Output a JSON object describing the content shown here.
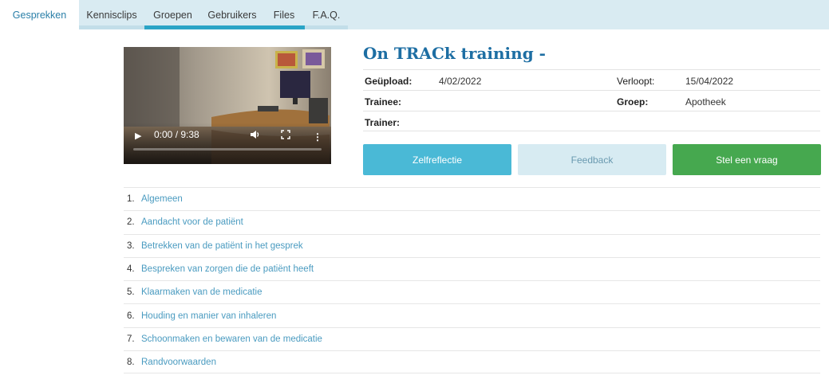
{
  "nav": {
    "tabs": [
      {
        "label": "Gesprekken"
      },
      {
        "label": "Kennisclips"
      },
      {
        "label": "Groepen"
      },
      {
        "label": "Gebruikers"
      },
      {
        "label": "Files"
      },
      {
        "label": "F.A.Q."
      }
    ],
    "active": "Gesprekken"
  },
  "video": {
    "time": "0:00 / 9:38",
    "progress": 0
  },
  "session": {
    "title": "On TRACk training -",
    "uploaded_label": "Geüpload:",
    "uploaded_value": "4/02/2022",
    "expires_label": "Verloopt:",
    "expires_value": "15/04/2022",
    "trainee_label": "Trainee:",
    "trainee_value": "",
    "group_label": "Groep:",
    "group_value": "Apotheek",
    "trainer_label": "Trainer:",
    "trainer_value": ""
  },
  "actions": {
    "selfreflection": "Zelfreflectie",
    "feedback": "Feedback",
    "ask_question": "Stel een vraag"
  },
  "topics": [
    {
      "num": "1.",
      "label": "Algemeen"
    },
    {
      "num": "2.",
      "label": "Aandacht voor de patiënt"
    },
    {
      "num": "3.",
      "label": "Betrekken van de patiënt in het gesprek"
    },
    {
      "num": "4.",
      "label": "Bespreken van zorgen die de patiënt heeft"
    },
    {
      "num": "5.",
      "label": "Klaarmaken van de medicatie"
    },
    {
      "num": "6.",
      "label": "Houding en manier van inhaleren"
    },
    {
      "num": "7.",
      "label": "Schoonmaken en bewaren van de medicatie"
    },
    {
      "num": "8.",
      "label": "Randvoorwaarden"
    }
  ],
  "colors": {
    "nav_bg": "#d9ebf2",
    "title": "#1d6ea3",
    "selfreflection_btn": "#4ab9d6",
    "feedback_btn": "#d7ebf2",
    "question_btn": "#46a84f",
    "link": "#4a9bc0"
  }
}
